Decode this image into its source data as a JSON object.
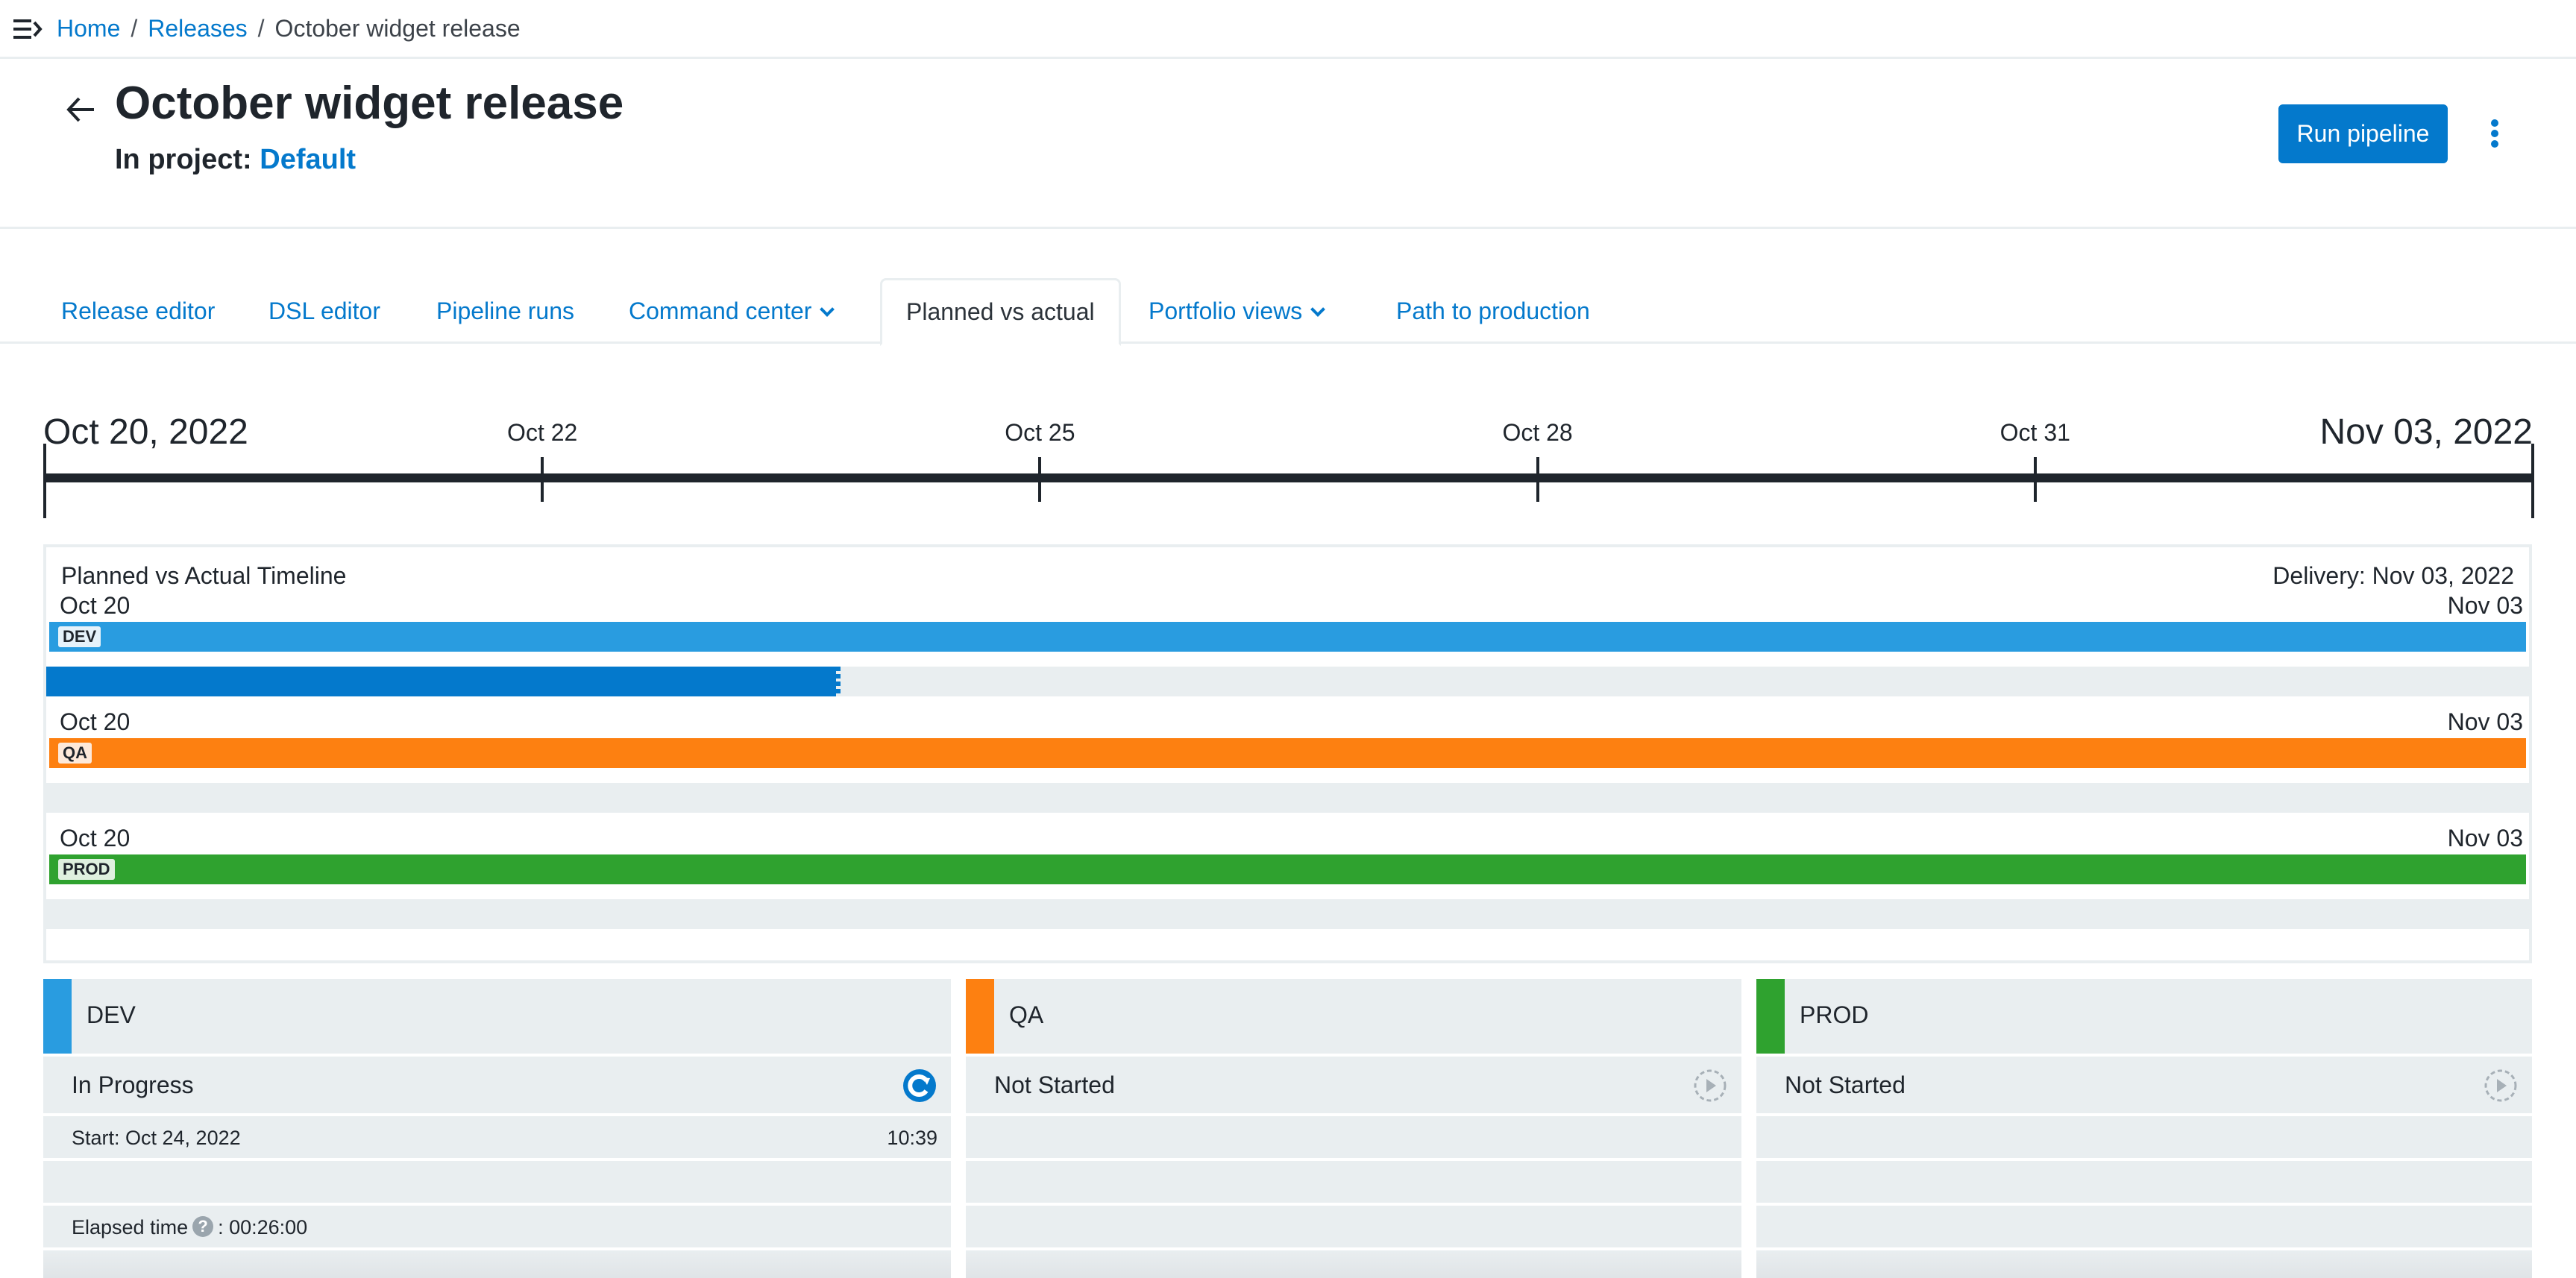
{
  "breadcrumb": {
    "menu_icon": "menu-expand-icon",
    "items": [
      {
        "label": "Home",
        "link": true
      },
      {
        "label": "Releases",
        "link": true
      },
      {
        "label": "October widget release",
        "link": false
      }
    ],
    "separator": "/"
  },
  "header": {
    "back_icon": "arrow-left-icon",
    "title": "October widget release",
    "project_prefix": "In project:",
    "project_name": "Default",
    "run_button": "Run pipeline",
    "more_icon": "kebab-menu-icon"
  },
  "tabs": [
    {
      "label": "Release editor",
      "active": false,
      "dropdown": false
    },
    {
      "label": "DSL editor",
      "active": false,
      "dropdown": false
    },
    {
      "label": "Pipeline runs",
      "active": false,
      "dropdown": false
    },
    {
      "label": "Command center",
      "active": false,
      "dropdown": true
    },
    {
      "label": "Planned vs actual",
      "active": true,
      "dropdown": false
    },
    {
      "label": "Portfolio views",
      "active": false,
      "dropdown": true
    },
    {
      "label": "Path to production",
      "active": false,
      "dropdown": false
    }
  ],
  "chart_data": {
    "type": "timeline",
    "title": "Planned vs Actual Timeline",
    "delivery_label": "Delivery: Nov 03, 2022",
    "axis": {
      "start_label": "Oct 20, 2022",
      "end_label": "Nov 03, 2022",
      "ticks": [
        "Oct 22",
        "Oct 25",
        "Oct 28",
        "Oct 31"
      ]
    },
    "stages": [
      {
        "name": "DEV",
        "color": "#299ce0",
        "badge_bg": "#e6f2fa",
        "planned_start": "Oct 20",
        "planned_end": "Nov 03",
        "actual_progress": 0.318
      },
      {
        "name": "QA",
        "color": "#fd8011",
        "badge_bg": "#fde9da",
        "planned_start": "Oct 20",
        "planned_end": "Nov 03",
        "actual_progress": 0
      },
      {
        "name": "PROD",
        "color": "#2fa22f",
        "badge_bg": "#dff0df",
        "planned_start": "Oct 20",
        "planned_end": "Nov 03",
        "actual_progress": 0
      }
    ],
    "actual_color": "#0479cc"
  },
  "cards": [
    {
      "name": "DEV",
      "color": "#299ce0",
      "status": "In Progress",
      "status_icon": "in-progress-icon",
      "start": "Start: Oct 24, 2022",
      "start_time": "10:39",
      "elapsed_label": "Elapsed time",
      "elapsed_value": ": 00:26:00"
    },
    {
      "name": "QA",
      "color": "#fd8011",
      "status": "Not Started",
      "status_icon": "not-started-icon"
    },
    {
      "name": "PROD",
      "color": "#2fa22f",
      "status": "Not Started",
      "status_icon": "not-started-icon"
    }
  ]
}
